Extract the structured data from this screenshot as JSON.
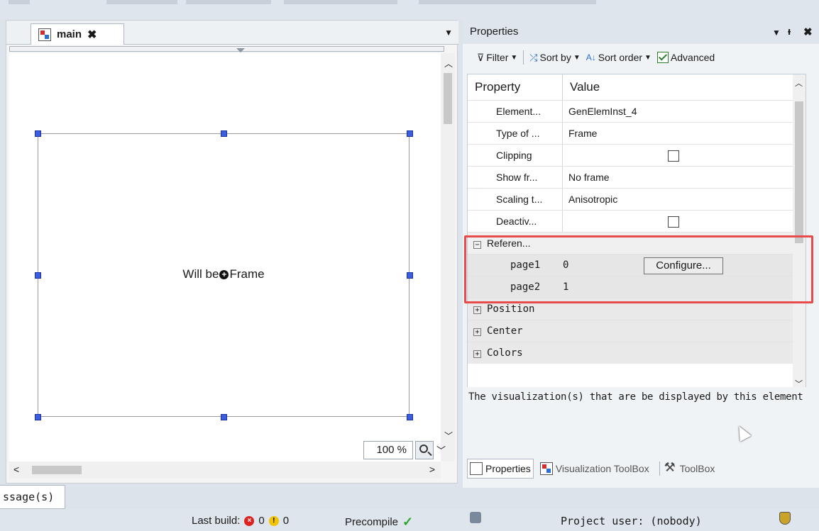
{
  "editor": {
    "tab_label": "main",
    "tab_close": "✖",
    "tab_dropdown": "▼",
    "frame_text_before": "Will be",
    "frame_text_after": "Frame",
    "zoom": "100 %",
    "msg_tab_label": "ssage(s)"
  },
  "properties": {
    "title": "Properties",
    "title_dropdown": "▼",
    "title_pin": "ᵻ",
    "title_close": "✖",
    "toolbar": {
      "filter": "Filter",
      "sort_by": "Sort by",
      "sort_order": "Sort order",
      "advanced": "Advanced"
    },
    "columns": {
      "property": "Property",
      "value": "Value"
    },
    "rows": [
      {
        "name": "Element...",
        "value": "GenElemInst_4"
      },
      {
        "name": "Type of ...",
        "value": "Frame"
      },
      {
        "name": "Clipping",
        "value": ""
      },
      {
        "name": "Show fr...",
        "value": "No frame"
      },
      {
        "name": "Scaling t...",
        "value": "Anisotropic"
      },
      {
        "name": "Deactiv...",
        "value": ""
      }
    ],
    "references": {
      "label": "Referen...",
      "button": "Configure...",
      "pages": [
        {
          "name": "page1",
          "value": "0"
        },
        {
          "name": "page2",
          "value": "1"
        }
      ]
    },
    "groups": [
      "Position",
      "Center",
      "Colors"
    ],
    "description": "The visualization(s) that are be displayed by this element",
    "bottom_tabs": {
      "properties": "Properties",
      "vis_toolbox": "Visualization ToolBox",
      "toolbox": "ToolBox"
    }
  },
  "statusbar": {
    "last_build": "Last build:",
    "errors": "0",
    "warnings": "0",
    "precompile": "Precompile",
    "project_user": "Project user: (nobody)"
  }
}
